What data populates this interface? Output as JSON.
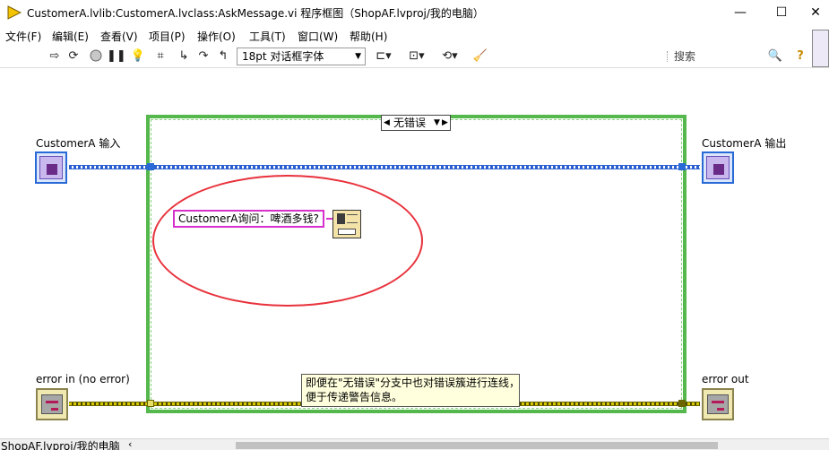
{
  "window": {
    "title": "CustomerA.lvlib:CustomerA.lvclass:AskMessage.vi 程序框图（ShopAF.lvproj/我的电脑）",
    "minimize_glyph": "—",
    "maximize_glyph": "☐",
    "close_glyph": "✕"
  },
  "menu": {
    "items": [
      "文件(F)",
      "编辑(E)",
      "查看(V)",
      "项目(P)",
      "操作(O)",
      "工具(T)",
      "窗口(W)",
      "帮助(H)"
    ]
  },
  "toolbar": {
    "font_select_value": "18pt 对话框字体",
    "search_placeholder": "搜索",
    "help_glyph": "?"
  },
  "diagram": {
    "case_selector_value": "无错误",
    "terminals": {
      "class_in_label": "CustomerA 输入",
      "class_out_label": "CustomerA 输出",
      "error_in_label": "error in (no error)",
      "error_out_label": "error out"
    },
    "string_constant": "CustomerA询问：啤酒多钱?",
    "comment": "即便在\"无错误\"分支中也对错误簇进行连线，\n便于传递警告信息。"
  },
  "statusbar": {
    "project_path": "ShopAF.lvproj/我的电脑"
  },
  "colors": {
    "case_frame": "#55b84c",
    "class_wire": "#2a5fd1",
    "error_wire": "#d6c900",
    "string_wire": "#d631cc",
    "annotation_ellipse": "#e8323c"
  }
}
